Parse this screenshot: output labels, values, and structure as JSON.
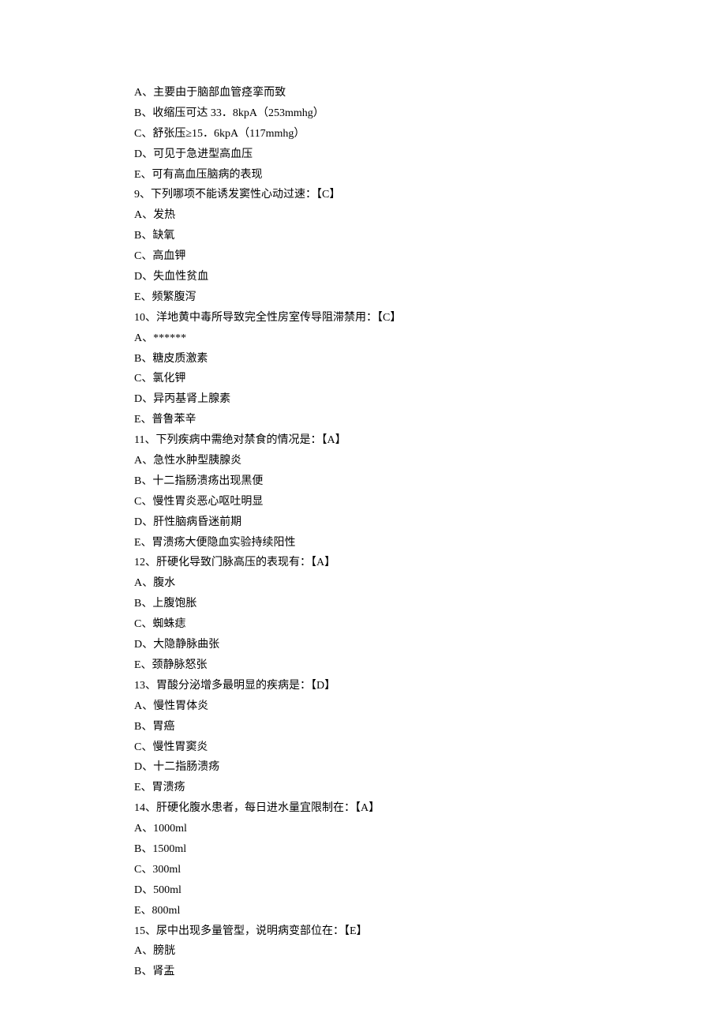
{
  "lines": [
    "A、主要由于脑部血管痉挛而致",
    "B、收缩压可达 33．8kpA（253mmhg）",
    "C、舒张压≥15．6kpA（117mmhg）",
    "D、可见于急进型高血压",
    "E、可有高血压脑病的表现",
    "9、下列哪项不能诱发窦性心动过速：【C】",
    "A、发热",
    "B、缺氧",
    "C、高血钾",
    "D、失血性贫血",
    "E、频繁腹泻",
    "10、洋地黄中毒所导致完全性房室传导阻滞禁用：【C】",
    "A、******",
    "B、糖皮质激素",
    "C、氯化钾",
    "D、异丙基肾上腺素",
    "E、普鲁苯辛",
    "11、下列疾病中需绝对禁食的情况是：【A】",
    "A、急性水肿型胰腺炎",
    "B、十二指肠溃疡出现黑便",
    "C、慢性胃炎恶心呕吐明显",
    "D、肝性脑病昏迷前期",
    "E、胃溃疡大便隐血实验持续阳性",
    "12、肝硬化导致门脉高压的表现有：【A】",
    "A、腹水",
    "B、上腹饱胀",
    "C、蜘蛛痣",
    "D、大隐静脉曲张",
    "E、颈静脉怒张",
    "13、胃酸分泌增多最明显的疾病是：【D】",
    "A、慢性胃体炎",
    "B、胃癌",
    "C、慢性胃窦炎",
    "D、十二指肠溃疡",
    "E、胃溃疡",
    "14、肝硬化腹水患者，每日进水量宜限制在：【A】",
    "A、1000ml",
    "B、1500ml",
    "C、300ml",
    "D、500ml",
    "E、800ml",
    "15、尿中出现多量管型，说明病变部位在：【E】",
    "A、膀胱",
    "B、肾盂"
  ]
}
